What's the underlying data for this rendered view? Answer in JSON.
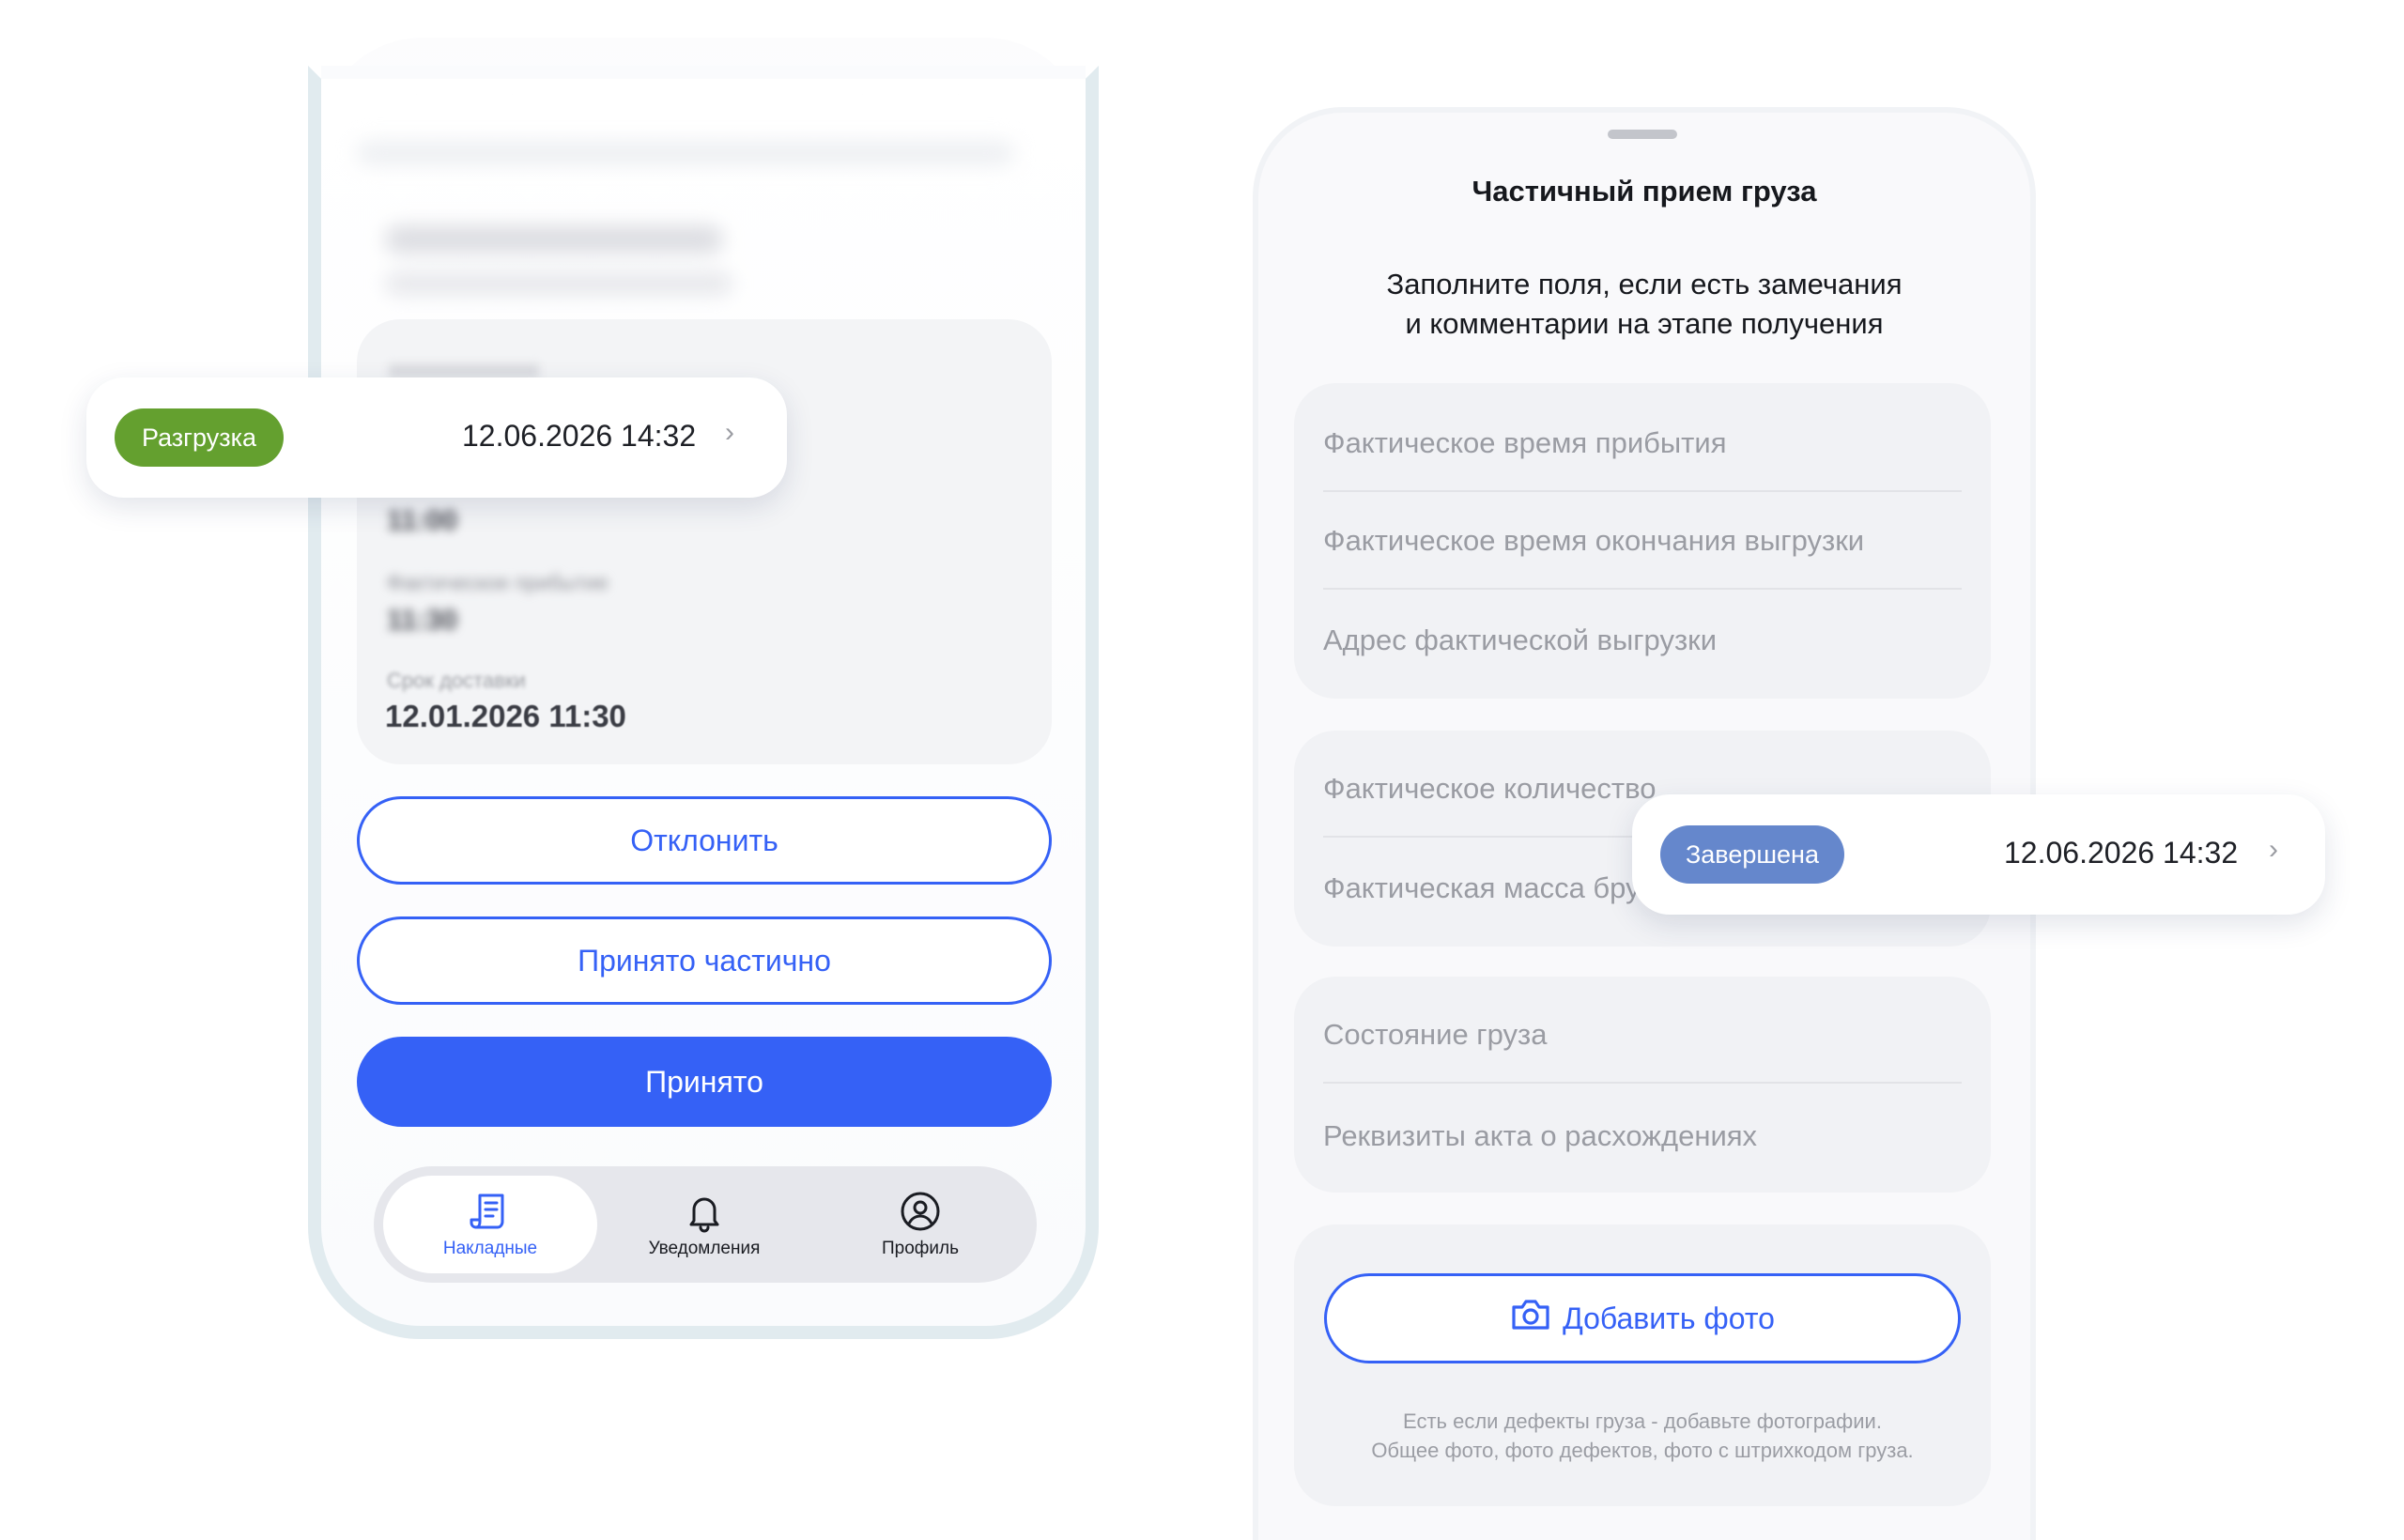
{
  "left_phone": {
    "unloading_card": {
      "status": "Разгрузка",
      "status_color": "#64a02f",
      "datetime": "12.06.2026 14:32"
    },
    "delivery": {
      "label": "Срок доставки",
      "value": "12.01.2026 11:30"
    },
    "actions": {
      "reject": "Отклонить",
      "partial": "Принято частично",
      "accept": "Принято"
    },
    "tabs": [
      {
        "label": "Накладные",
        "icon": "invoice-icon",
        "active": true
      },
      {
        "label": "Уведомления",
        "icon": "bell-icon",
        "active": false
      },
      {
        "label": "Профиль",
        "icon": "profile-icon",
        "active": false
      }
    ],
    "accent_color": "#3561f6"
  },
  "right_phone": {
    "title": "Частичный прием груза",
    "subtitle_line1": "Заполните поля, если есть замечания",
    "subtitle_line2": "и комментарии на этапе получения",
    "group1": [
      "Фактическое время прибытия",
      "Фактическое время окончания выгрузки",
      "Адрес фактической выгрузки"
    ],
    "group2": [
      "Фактическое количество",
      "Фактическая масса брутто"
    ],
    "group3": [
      "Состояние груза",
      "Реквизиты акта о расхождениях"
    ],
    "add_photo": "Добавить фото",
    "photo_hint_line1": "Есть если дефекты груза - добавьте фотографии.",
    "photo_hint_line2": "Общее фото, фото дефектов, фото с штрихкодом груза."
  },
  "completed_card": {
    "status": "Завершена",
    "status_color": "#6587cc",
    "datetime": "12.06.2026 14:32"
  }
}
